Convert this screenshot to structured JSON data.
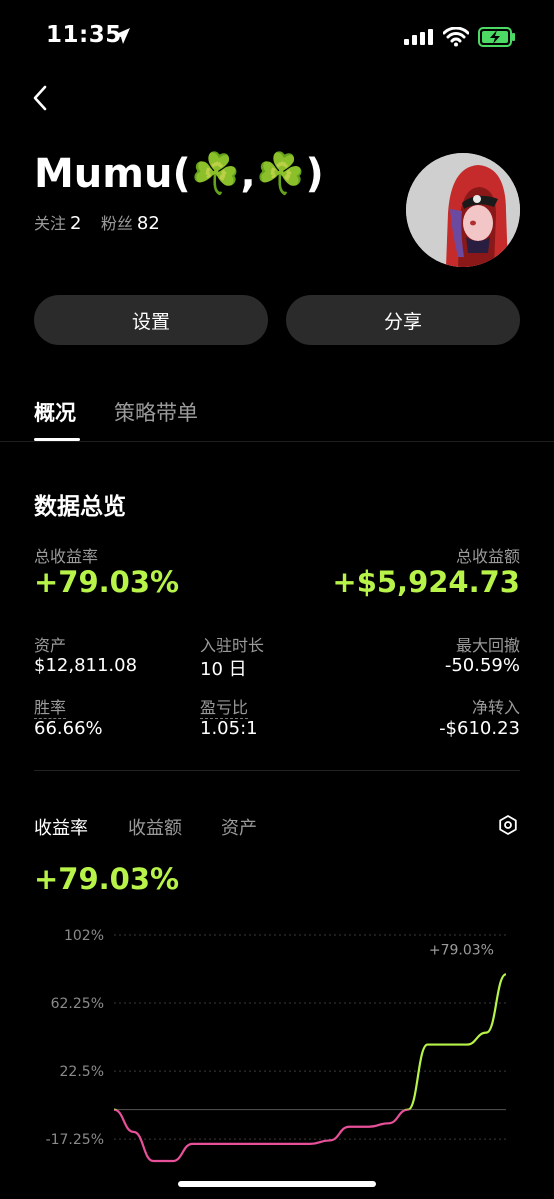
{
  "status_bar": {
    "time": "11:35"
  },
  "profile": {
    "name": "Mumu(☘️,☘️)",
    "follow_label": "关注",
    "follow_count": "2",
    "fans_label": "粉丝",
    "fans_count": "82"
  },
  "buttons": {
    "settings": "设置",
    "share": "分享"
  },
  "tabs": {
    "overview": "概况",
    "strategy": "策略带单"
  },
  "overview": {
    "title": "数据总览",
    "total_return_rate_label": "总收益率",
    "total_return_rate": "+79.03%",
    "total_return_amount_label": "总收益额",
    "total_return_amount": "+$5,924.73",
    "assets_label": "资产",
    "assets": "$12,811.08",
    "duration_label": "入驻时长",
    "duration": "10 日",
    "max_drawdown_label": "最大回撤",
    "max_drawdown": "-50.59%",
    "win_rate_label": "胜率",
    "win_rate": "66.66%",
    "pl_ratio_label": "盈亏比",
    "pl_ratio": "1.05:1",
    "net_transfer_label": "净转入",
    "net_transfer": "-$610.23"
  },
  "chart_tabs": {
    "return_rate": "收益率",
    "return_amount": "收益额",
    "assets": "资产"
  },
  "chart_value": "+79.03%",
  "colors": {
    "accent_green": "#b8f34a",
    "negative_pink": "#e8509a",
    "background": "#000000"
  },
  "chart_data": {
    "type": "line",
    "y_tick_labels": [
      "102%",
      "62.25%",
      "22.5%",
      "-17.25%"
    ],
    "y_ticks": [
      102,
      62.25,
      22.5,
      -17.25
    ],
    "ylim": [
      -30,
      102
    ],
    "end_label": "+79.03%",
    "x": [
      0,
      1,
      2,
      3,
      4,
      5,
      6,
      7,
      8,
      9,
      10,
      11,
      12,
      13,
      14,
      15,
      16,
      17,
      18,
      19,
      20
    ],
    "values": [
      0,
      -13,
      -30,
      -30,
      -20,
      -20,
      -20,
      -20,
      -20,
      -20,
      -20,
      -18,
      -10,
      -10,
      -8,
      0,
      38,
      38,
      38,
      45,
      79.03
    ],
    "baseline": 0
  }
}
